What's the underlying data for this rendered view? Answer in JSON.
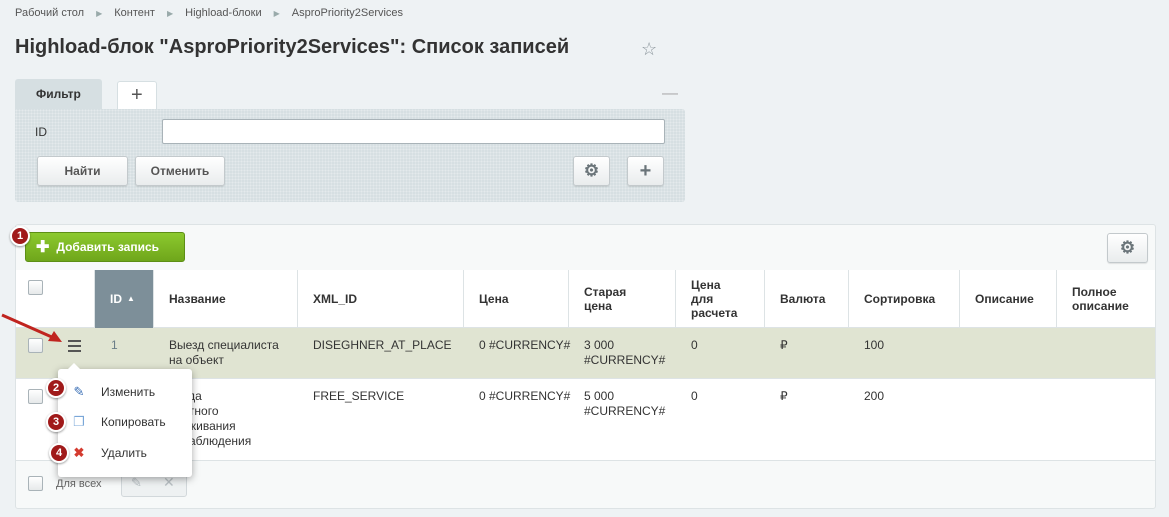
{
  "breadcrumb": [
    "Рабочий стол",
    "Контент",
    "Highload-блоки",
    "AsproPriority2Services"
  ],
  "page_title": "Highload-блок \"AsproPriority2Services\": Список записей",
  "filter": {
    "tab_label": "Фильтр",
    "field_label": "ID",
    "field_value": "",
    "find_label": "Найти",
    "cancel_label": "Отменить"
  },
  "toolbar": {
    "add_label": "Добавить запись"
  },
  "badges": [
    "1",
    "2",
    "3",
    "4"
  ],
  "columns": [
    "ID",
    "Название",
    "XML_ID",
    "Цена",
    "Старая цена",
    "Цена для расчета",
    "Валюта",
    "Сортировка",
    "Описание",
    "Полное описание"
  ],
  "rows": [
    {
      "id": "1",
      "name": "Выезд специалиста на объект",
      "xml_id": "DISEGHNER_AT_PLACE",
      "price": "0 #CURRENCY#",
      "old_price": "3 000 #CURRENCY#",
      "calc_price": "0",
      "currency": "₽",
      "sort": "100",
      "description": "",
      "full_description": ""
    },
    {
      "id": "",
      "name": "Неделя бесплатного обслуживания видеонаблюдения",
      "name_visible": "ыгода\nплатного\nслуживания\nеонаблюдения",
      "xml_id": "FREE_SERVICE",
      "price": "0 #CURRENCY#",
      "old_price": "5 000 #CURRENCY#",
      "calc_price": "0",
      "currency": "₽",
      "sort": "200",
      "description": "",
      "full_description": ""
    }
  ],
  "footer": {
    "for_all_label": "Для всех"
  },
  "context_menu": [
    {
      "label": "Изменить",
      "icon": "edit-icon"
    },
    {
      "label": "Копировать",
      "icon": "copy-icon"
    },
    {
      "label": "Удалить",
      "icon": "delete-icon"
    }
  ],
  "colors": {
    "accent_green": "#7cb823",
    "sorted_header": "#7d8f99",
    "active_row": "#e0e4d2",
    "badge": "#a01a1a"
  }
}
